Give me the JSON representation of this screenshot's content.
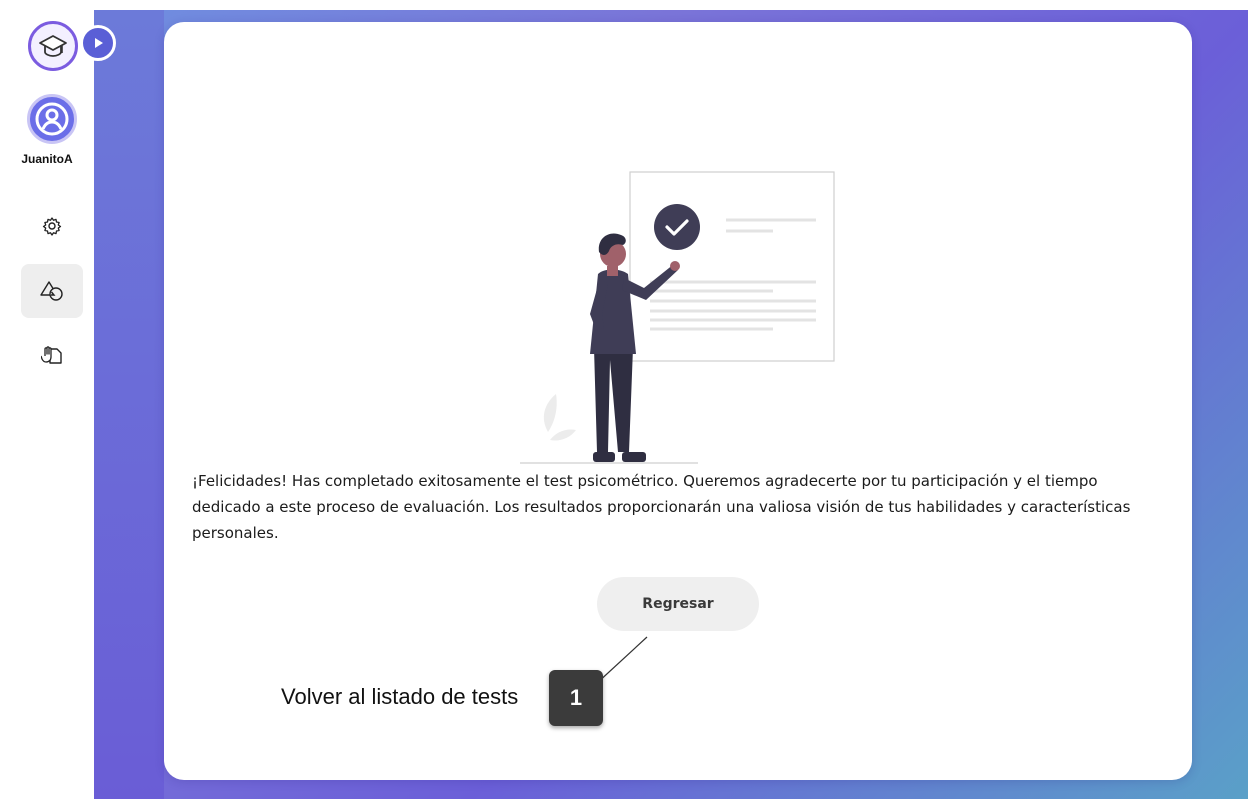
{
  "sidebar": {
    "username": "JuanitoA",
    "items": [
      {
        "name": "settings",
        "icon": "gear-icon"
      },
      {
        "name": "tests",
        "icon": "shapes-icon",
        "active": true
      },
      {
        "name": "cases",
        "icon": "hand-document-icon"
      }
    ]
  },
  "main": {
    "message": "¡Felicidades! Has completado exitosamente el test psicométrico. Queremos agradecerte por tu participación y el tiempo dedicado a este proceso de evaluación. Los resultados proporcionarán una valiosa visión de tus habilidades y características personales.",
    "back_button_label": "Regresar"
  },
  "annotation": {
    "label": "Volver al listado de tests",
    "number": "1"
  },
  "colors": {
    "accent": "#5a5fd6",
    "card": "#ffffff",
    "button": "#efefef"
  }
}
